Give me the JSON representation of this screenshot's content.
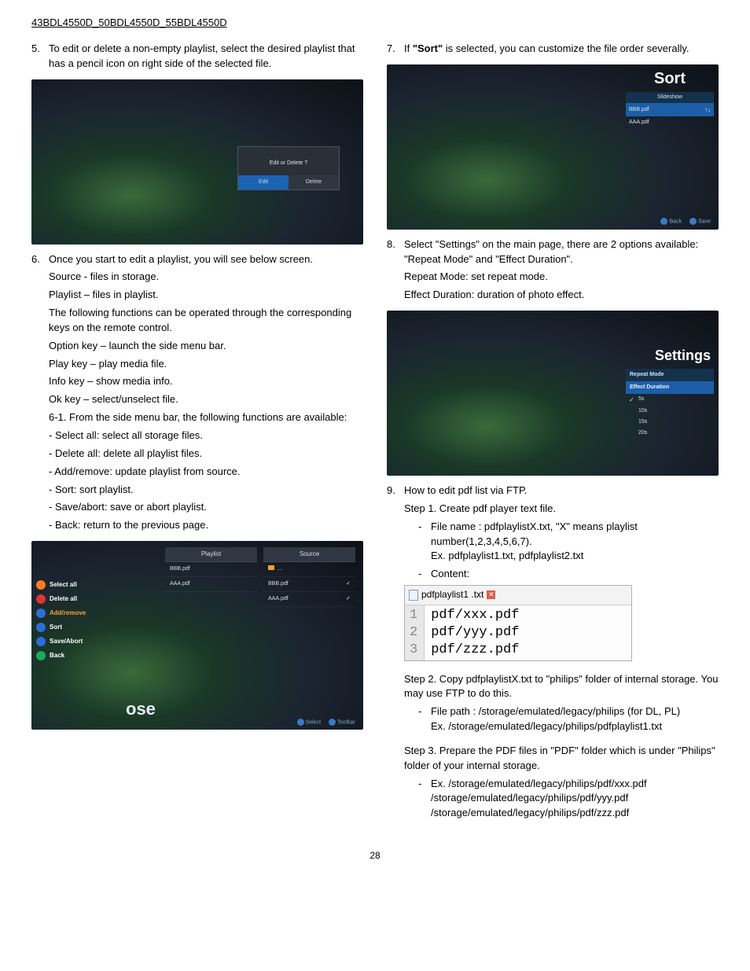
{
  "header": "43BDL4550D_50BDL4550D_55BDL4550D",
  "left": {
    "item5": {
      "num": "5.",
      "text": "To edit or delete a non-empty playlist, select the desired playlist that has a pencil icon on right side of the selected file."
    },
    "dialog": {
      "title": "Edit or Delete ?",
      "edit": "Edit",
      "delete": "Delete"
    },
    "item6": {
      "num": "6.",
      "lines": [
        "Once you start to edit a playlist, you will see below screen.",
        "Source - files in storage.",
        "Playlist – files in playlist.",
        "The following functions can be operated through the corresponding keys on the remote control.",
        "Option key – launch the side menu bar.",
        "Play key – play media file.",
        "Info key – show media info.",
        "Ok key – select/unselect file.",
        "6-1. From the side menu bar, the following functions are available:",
        "- Select all: select all storage files.",
        "- Delete all: delete all playlist files.",
        "- Add/remove: update playlist from source.",
        "- Sort: sort playlist.",
        "- Save/abort: save or abort playlist.",
        "- Back: return to the previous page."
      ]
    },
    "sidemenu": [
      "Select all",
      "Delete all",
      "Add/remove",
      "Sort",
      "Save/Abort",
      "Back"
    ],
    "ose": "ose",
    "panel_playlist": {
      "head": "Playlist",
      "rows": [
        "BBB.pdf",
        "AAA.pdf"
      ]
    },
    "panel_source": {
      "head": "Source",
      "folder": "...",
      "rows": [
        "BBB.pdf",
        "AAA.pdf"
      ]
    },
    "foot": {
      "a": "Select",
      "b": "Toolbar"
    }
  },
  "right": {
    "item7": {
      "num": "7.",
      "pre": "If ",
      "bold": "\"Sort\"",
      "post": " is selected, you can customize the file order severally."
    },
    "sort": {
      "title": "Sort",
      "sub": "Slideshow",
      "rows": [
        "BBB.pdf",
        "AAA.pdf"
      ],
      "foot_a": "Back",
      "foot_b": "Save"
    },
    "item8": {
      "num": "8.",
      "lines": [
        "Select \"Settings\" on the main page, there are 2 options available: \"Repeat Mode\" and \"Effect Duration\".",
        "Repeat Mode: set repeat mode.",
        "Effect Duration: duration of photo effect."
      ]
    },
    "settings": {
      "title": "Settings",
      "h1": "Repeat Mode",
      "h2": "Effect Duration",
      "rows": [
        "5s",
        "10s",
        "15s",
        "20s"
      ]
    },
    "item9": {
      "num": "9.",
      "intro_a": "How to edit pdf list via FTP.",
      "intro_b": "Step 1. Create pdf player text file.",
      "sub1_a": "File name : pdfplaylistX.txt, \"X\" means playlist number(1,2,3,4,5,6,7).",
      "sub1_b": "Ex. pdfplaylist1.txt, pdfplaylist2.txt",
      "sub2": "Content:",
      "editor": {
        "tab": "pdfplaylist1 .txt",
        "lines": [
          "pdf/xxx.pdf",
          "pdf/yyy.pdf",
          "pdf/zzz.pdf"
        ],
        "nums": [
          "1",
          "2",
          "3"
        ]
      },
      "step2": "Step 2. Copy pdfplaylistX.txt to \"philips\" folder of internal storage. You may use FTP to do this.",
      "step2_sub_a": "File path : /storage/emulated/legacy/philips (for DL, PL)",
      "step2_sub_b": "Ex. /storage/emulated/legacy/philips/pdfplaylist1.txt",
      "step3": "Step 3. Prepare the PDF files in \"PDF\" folder which is under \"Philips\" folder of your internal storage.",
      "step3_sub": "Ex. /storage/emulated/legacy/philips/pdf/xxx.pdf\n/storage/emulated/legacy/philips/pdf/yyy.pdf\n/storage/emulated/legacy/philips/pdf/zzz.pdf"
    }
  },
  "page_num": "28"
}
